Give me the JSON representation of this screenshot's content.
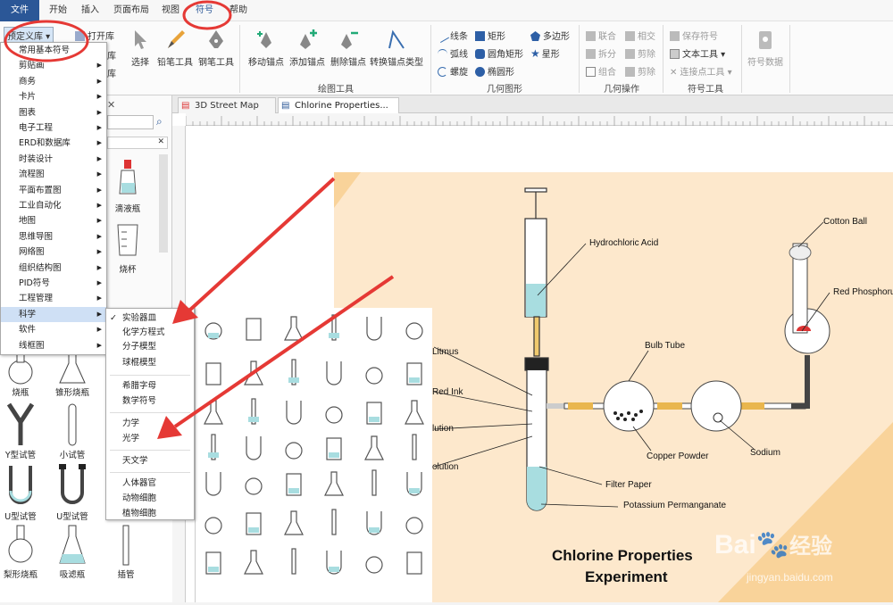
{
  "menubar": {
    "tabs": [
      "文件",
      "开始",
      "插入",
      "页面布局",
      "视图",
      "符号",
      "帮助"
    ]
  },
  "ribbon": {
    "library_button": "预定义库",
    "open_library": "打开库",
    "open_library_2": "库",
    "open_library_3": "库",
    "select": "选择",
    "pencil": "铅笔工具",
    "pen": "钢笔工具",
    "move_anchor": "移动锚点",
    "add_anchor": "添加锚点",
    "delete_anchor": "删除锚点",
    "convert_anchor": "转换锚点类型",
    "group_drawing_tools": "绘图工具",
    "line": "线条",
    "arc": "弧线",
    "spiral": "螺旋",
    "rect": "矩形",
    "round_rect": "圆角矩形",
    "ellipse": "椭圆形",
    "polygon": "多边形",
    "star": "星形",
    "group_geometry": "几何图形",
    "union": "联合",
    "split": "拆分",
    "combine": "组合",
    "intersect": "相交",
    "subtract": "剪除",
    "subtract2": "剪除",
    "group_geometry_ops": "几何操作",
    "save_symbol": "保存符号",
    "text_tool": "文本工具",
    "connect_point": "连接点工具",
    "group_symbol_tools": "符号工具",
    "symbol_data": "符号数据"
  },
  "dropdown": {
    "items": [
      "常用基本符号",
      "剪贴画",
      "商务",
      "卡片",
      "图表",
      "电子工程",
      "ERD和数据库",
      "时装设计",
      "流程图",
      "平面布置图",
      "工业自动化",
      "地图",
      "思维导图",
      "网络图",
      "组织结构图",
      "PID符号",
      "工程管理",
      "科学",
      "软件",
      "线框图"
    ],
    "selected": "科学"
  },
  "submenu": {
    "items": [
      "实验器皿",
      "化学方程式",
      "分子模型",
      "球棍模型",
      "希腊字母",
      "数学符号",
      "力学",
      "光学",
      "天文学",
      "人体器官",
      "动物细胞",
      "植物细胞"
    ],
    "checked": "实验器皿"
  },
  "tabs": [
    {
      "label": "3D Street Map"
    },
    {
      "label": "Chlorine Properties..."
    }
  ],
  "library": {
    "items": [
      "滴液瓶",
      "烧杯",
      "烧瓶",
      "锥形烧瓶",
      "Y型试管",
      "小试管",
      "U型试管",
      "U型试管",
      "梨形烧瓶",
      "吸滤瓶",
      "插管"
    ]
  },
  "diagram": {
    "title_line1": "Chlorine Properties",
    "title_line2": "Experiment",
    "labels": {
      "hcl": "Hydrochloric Acid",
      "cotton": "Cotton Ball",
      "phosphorus": "Red Phosphorus",
      "bulb": "Bulb Tube",
      "litmus": "Litmus",
      "redink": "Red Ink",
      "solution1": "lution",
      "solution2": "olution",
      "copper": "Copper Powder",
      "sodium": "Sodium",
      "filter": "Filter Paper",
      "kmno4": "Potassium Permanganate"
    }
  },
  "watermark": {
    "brand": "Bai",
    "brand_cn": "经验",
    "url": "jingyan.baidu.com"
  },
  "colors": {
    "file_tab": "#2b5797",
    "annotation": "#e53935",
    "page_bg": "#fde8cc"
  }
}
